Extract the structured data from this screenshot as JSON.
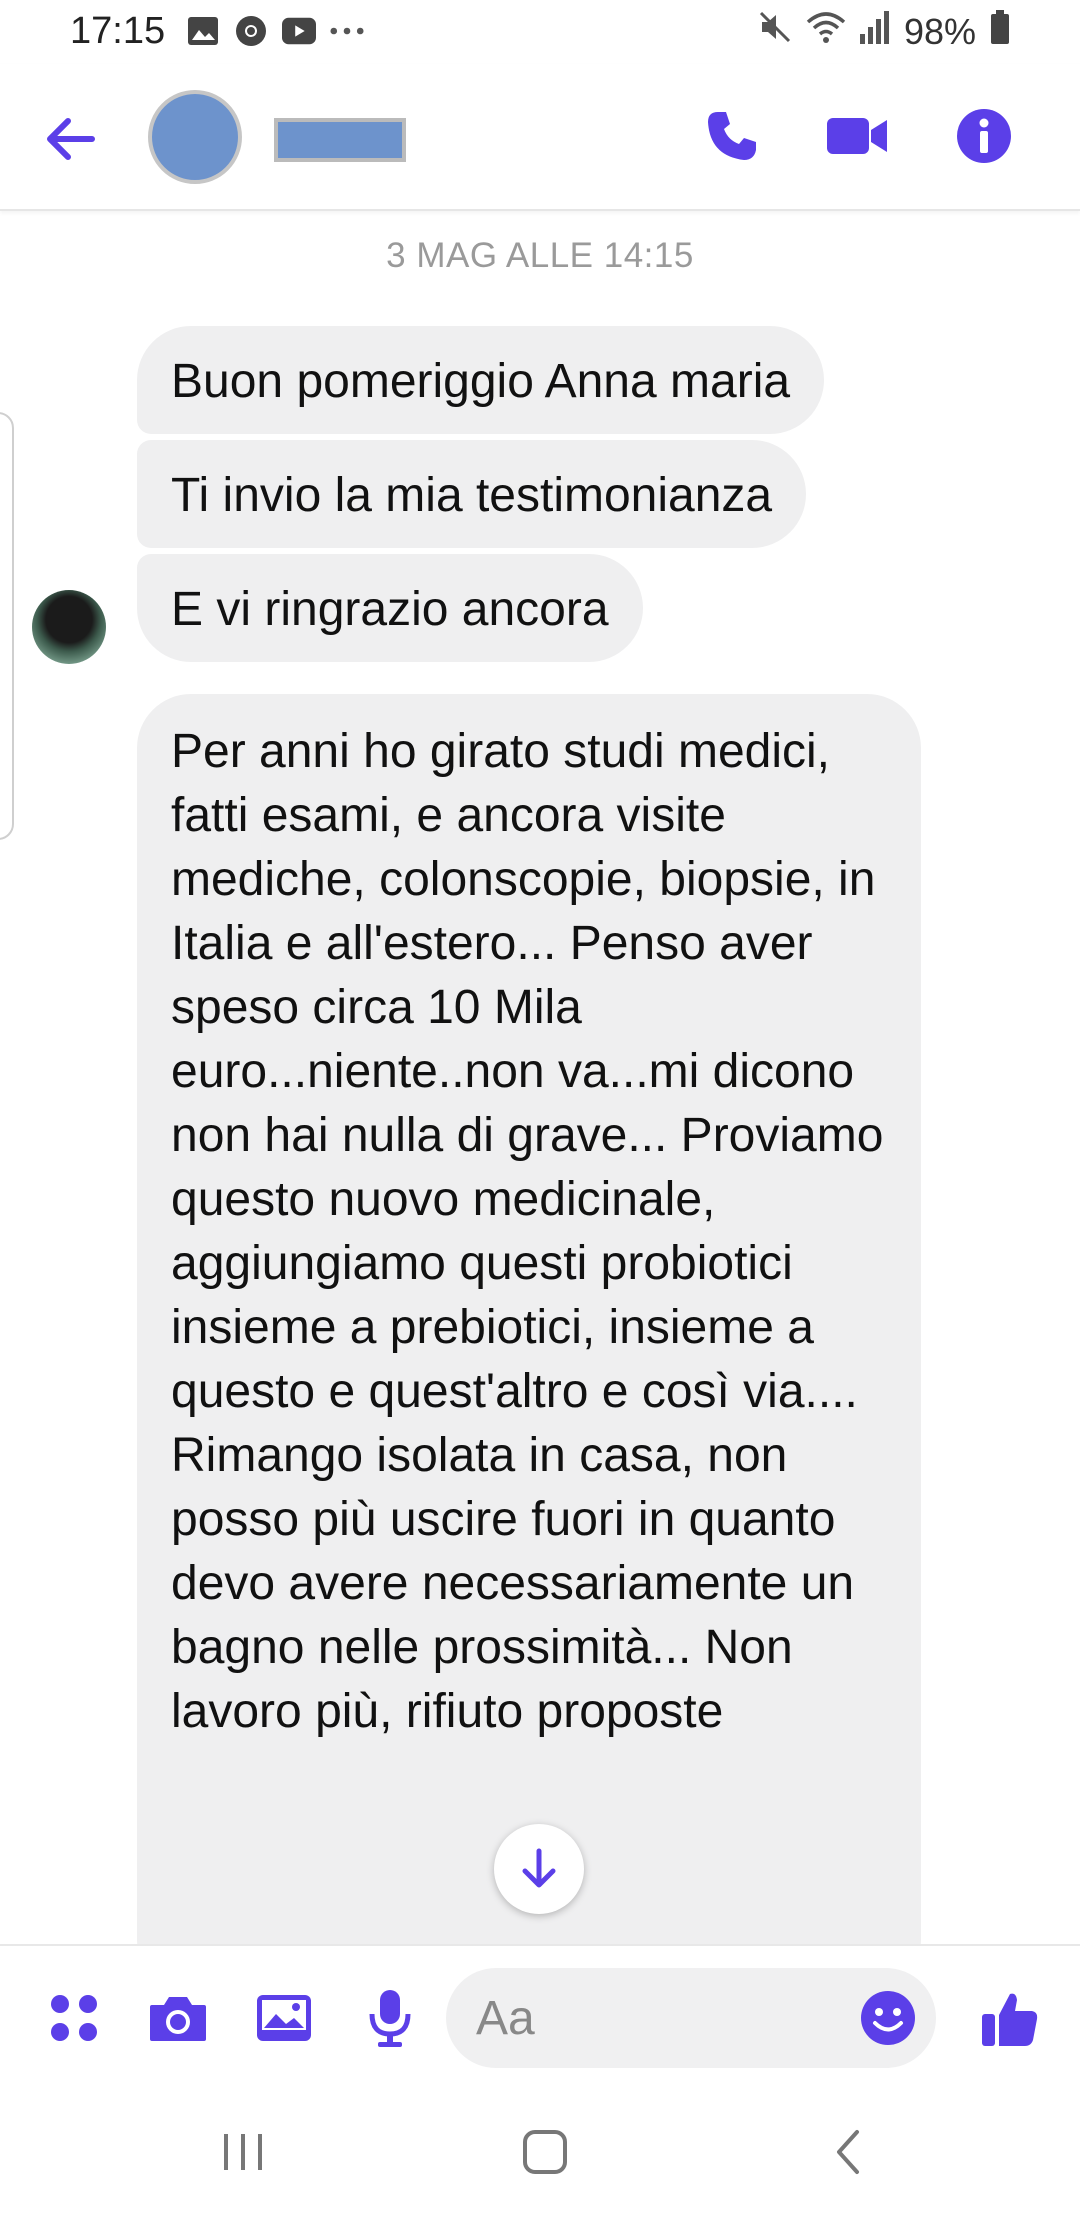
{
  "status_bar": {
    "time": "17:15",
    "left_icons": [
      "gallery-icon",
      "chrome-icon",
      "youtube-icon",
      "more-dots-icon"
    ],
    "right_icons": [
      "mute-icon",
      "wifi-icon",
      "signal-icon",
      "battery-icon"
    ],
    "battery": "98%"
  },
  "header": {
    "contact_name_redacted": true,
    "actions": [
      "phone-icon",
      "video-camera-icon",
      "info-icon"
    ]
  },
  "colors": {
    "accent": "#5b3fe8",
    "bubble": "#efeff0",
    "timestamp": "#9a9a9a"
  },
  "conversation": {
    "timestamp": "3 MAG ALLE 14:15",
    "messages": [
      {
        "text": "Buon pomeriggio Anna maria"
      },
      {
        "text": "Ti invio la mia testimonianza"
      },
      {
        "text": "E vi ringrazio ancora"
      },
      {
        "text": "Per anni ho girato studi medici, fatti esami, e ancora visite mediche, colonscopie, biopsie, in Italia e all'estero... Penso aver speso circa 10 Mila euro...niente..non va...mi dicono non hai nulla di grave... Proviamo questo nuovo medicinale, aggiungiamo questi probiotici insieme a prebiotici, insieme a questo e quest'altro e così via.... Rimango isolata in casa, non posso più uscire fuori in quanto devo avere necessariamente un bagno nelle prossimità... Non lavoro più, rifiuto proposte"
      }
    ]
  },
  "composer": {
    "placeholder": "Aa",
    "tools": [
      "apps-grid-icon",
      "camera-icon",
      "image-icon",
      "microphone-icon"
    ]
  },
  "nav": [
    "recents-icon",
    "home-icon",
    "back-nav-icon"
  ]
}
